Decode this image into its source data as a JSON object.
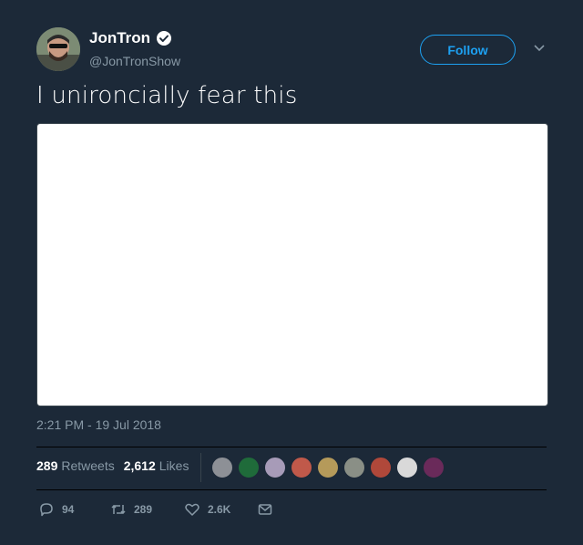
{
  "header": {
    "display_name": "JonTron",
    "handle": "@JonTronShow",
    "follow_label": "Follow",
    "verified": true
  },
  "tweet": {
    "text": "I unironcially fear this",
    "timestamp": "2:21 PM - 19 Jul 2018"
  },
  "stats": {
    "retweets_count": "289",
    "retweets_label": "Retweets",
    "likes_count": "2,612",
    "likes_label": "Likes"
  },
  "likers": [
    {
      "name": "liker-1",
      "color": "#8d9096"
    },
    {
      "name": "liker-2",
      "color": "#1f6b3a"
    },
    {
      "name": "liker-3",
      "color": "#a79bb8"
    },
    {
      "name": "liker-4",
      "color": "#c0594a"
    },
    {
      "name": "liker-5",
      "color": "#b59a5a"
    },
    {
      "name": "liker-6",
      "color": "#8a8f86"
    },
    {
      "name": "liker-7",
      "color": "#b0483a"
    },
    {
      "name": "liker-8",
      "color": "#d9d9d9"
    },
    {
      "name": "liker-9",
      "color": "#6a2a5a"
    }
  ],
  "actions": {
    "reply_count": "94",
    "retweet_count": "289",
    "like_count": "2.6K"
  },
  "colors": {
    "background": "#1c2938",
    "accent": "#1da1f2",
    "secondary_text": "#8899a6"
  },
  "icons": {
    "verified": "verified-badge-icon",
    "caret": "chevron-down-icon",
    "reply": "reply-icon",
    "retweet": "retweet-icon",
    "like": "heart-icon",
    "dm": "envelope-icon"
  }
}
